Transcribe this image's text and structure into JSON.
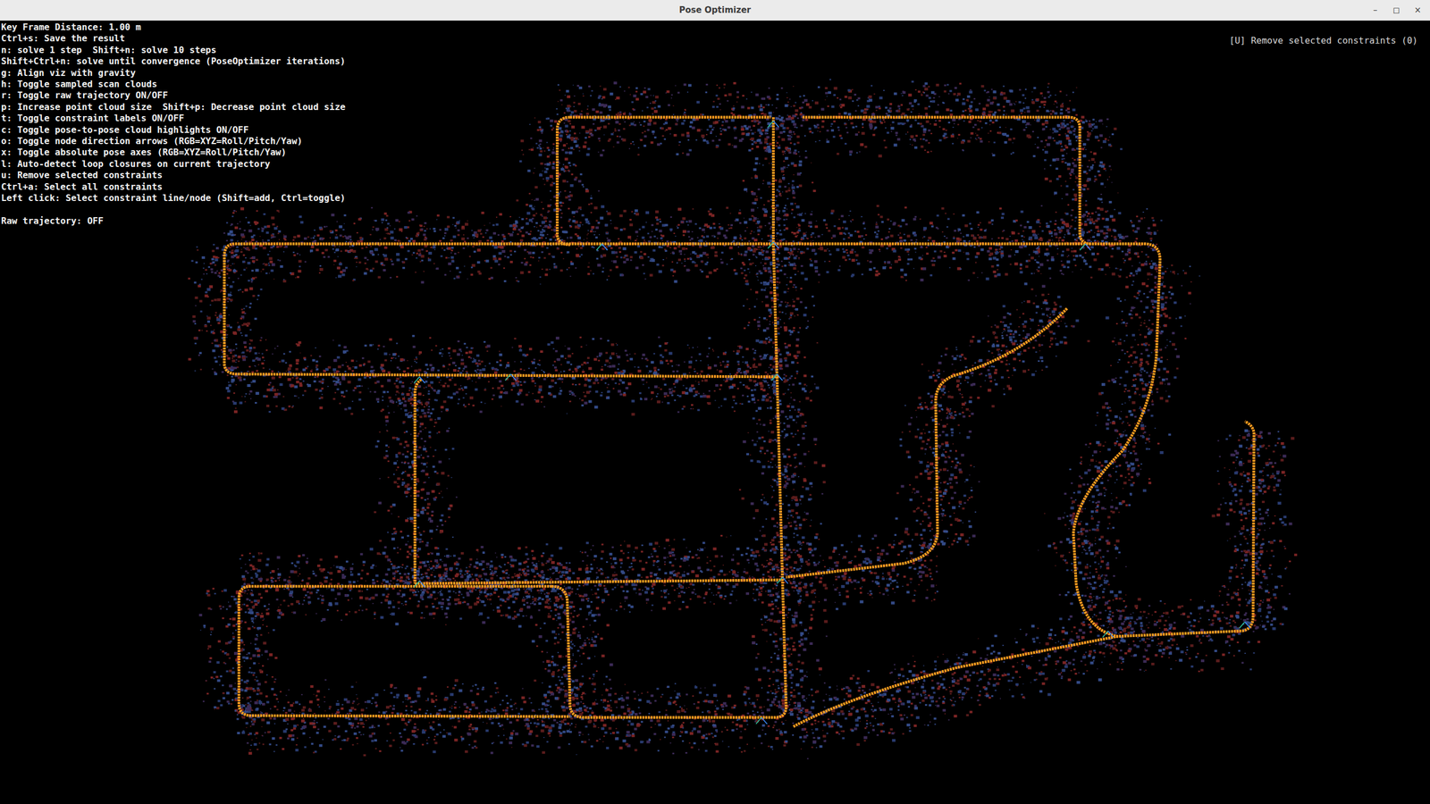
{
  "window": {
    "title": "Pose Optimizer",
    "controls": [
      "–",
      "◻",
      "×"
    ]
  },
  "help_lines": [
    "Key Frame Distance: 1.00 m",
    "Ctrl+s: Save the result",
    "n: solve 1 step  Shift+n: solve 10 steps",
    "Shift+Ctrl+n: solve until convergence (PoseOptimizer iterations)",
    "g: Align viz with gravity",
    "h: Toggle sampled scan clouds",
    "r: Toggle raw trajectory ON/OFF",
    "p: Increase point cloud size  Shift+p: Decrease point cloud size",
    "t: Toggle constraint labels ON/OFF",
    "c: Toggle pose-to-pose cloud highlights ON/OFF",
    "o: Toggle node direction arrows (RGB=XYZ=Roll/Pitch/Yaw)",
    "x: Toggle absolute pose axes (RGB=XYZ=Roll/Pitch/Yaw)",
    "l: Auto-detect loop closures on current trajectory",
    "u: Remove selected constraints",
    "Ctrl+a: Select all constraints",
    "Left click: Select constraint line/node (Shift=add, Ctrl=toggle)"
  ],
  "status": "Raw trajectory: OFF",
  "action_hint": "[U] Remove selected constraints (0)"
}
